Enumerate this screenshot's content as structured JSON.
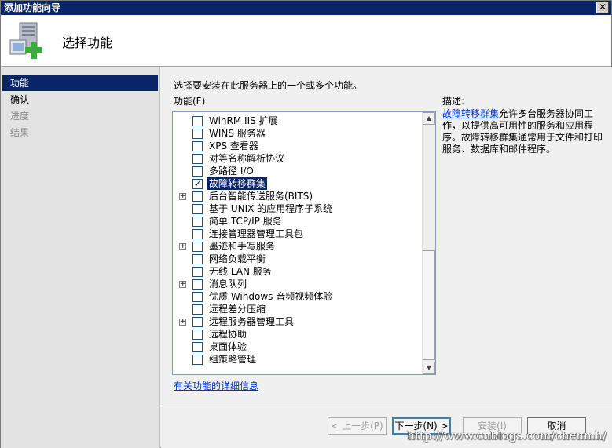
{
  "window": {
    "title": "添加功能向导",
    "close_glyph": "✕"
  },
  "header": {
    "title": "选择功能",
    "icon": "server-add-icon"
  },
  "nav": {
    "items": [
      {
        "label": "功能",
        "state": "active"
      },
      {
        "label": "确认",
        "state": "normal"
      },
      {
        "label": "进度",
        "state": "disabled"
      },
      {
        "label": "结果",
        "state": "disabled"
      }
    ]
  },
  "main": {
    "instruction": "选择要安装在此服务器上的一个或多个功能。",
    "features_label": "功能(F):",
    "description_label": "描述:",
    "description_link": "故障转移群集",
    "description_text": "允许多台服务器协同工作，以提供高可用性的服务和应用程序。故障转移群集通常用于文件和打印服务、数据库和邮件程序。",
    "more_info_link": "有关功能的详细信息",
    "features": [
      {
        "label": "WinRM IIS 扩展",
        "checked": false,
        "expandable": false,
        "selected": false
      },
      {
        "label": "WINS 服务器",
        "checked": false,
        "expandable": false,
        "selected": false
      },
      {
        "label": "XPS 查看器",
        "checked": false,
        "expandable": false,
        "selected": false
      },
      {
        "label": "对等名称解析协议",
        "checked": false,
        "expandable": false,
        "selected": false
      },
      {
        "label": "多路径 I/O",
        "checked": false,
        "expandable": false,
        "selected": false
      },
      {
        "label": "故障转移群集",
        "checked": true,
        "expandable": false,
        "selected": true
      },
      {
        "label": "后台智能传送服务(BITS)",
        "checked": false,
        "expandable": true,
        "selected": false
      },
      {
        "label": "基于 UNIX 的应用程序子系统",
        "checked": false,
        "expandable": false,
        "selected": false
      },
      {
        "label": "简单 TCP/IP 服务",
        "checked": false,
        "expandable": false,
        "selected": false
      },
      {
        "label": "连接管理器管理工具包",
        "checked": false,
        "expandable": false,
        "selected": false
      },
      {
        "label": "墨迹和手写服务",
        "checked": false,
        "expandable": true,
        "selected": false
      },
      {
        "label": "网络负载平衡",
        "checked": false,
        "expandable": false,
        "selected": false
      },
      {
        "label": "无线 LAN 服务",
        "checked": false,
        "expandable": false,
        "selected": false
      },
      {
        "label": "消息队列",
        "checked": false,
        "expandable": true,
        "selected": false
      },
      {
        "label": "优质 Windows 音频视频体验",
        "checked": false,
        "expandable": false,
        "selected": false
      },
      {
        "label": "远程差分压缩",
        "checked": false,
        "expandable": false,
        "selected": false
      },
      {
        "label": "远程服务器管理工具",
        "checked": false,
        "expandable": true,
        "selected": false
      },
      {
        "label": "远程协助",
        "checked": false,
        "expandable": false,
        "selected": false
      },
      {
        "label": "桌面体验",
        "checked": false,
        "expandable": false,
        "selected": false
      },
      {
        "label": "组策略管理",
        "checked": false,
        "expandable": false,
        "selected": false
      }
    ]
  },
  "footer": {
    "back_label": "< 上一步(P)",
    "next_label": "下一步(N) >",
    "install_label": "安装(I)",
    "cancel_label": "取消"
  },
  "watermark": "http://www.cnblogs.com/chenmh/"
}
